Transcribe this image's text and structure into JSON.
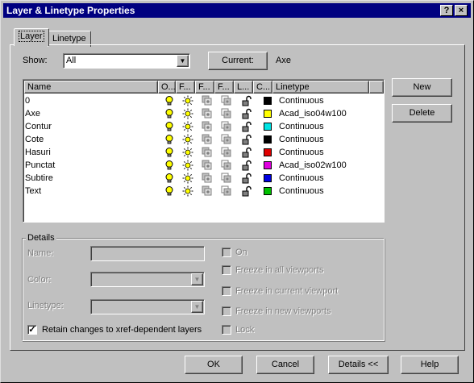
{
  "window": {
    "title": "Layer & Linetype Properties",
    "help_glyph": "?",
    "close_glyph": "×"
  },
  "tabs": [
    {
      "label": "Layer",
      "active": true
    },
    {
      "label": "Linetype",
      "active": false
    }
  ],
  "filter": {
    "show_label": "Show:",
    "show_value": "All",
    "current_button": "Current:",
    "current_value": "Axe"
  },
  "buttons": {
    "new": "New",
    "delete": "Delete",
    "ok": "OK",
    "cancel": "Cancel",
    "details": "Details <<",
    "help": "Help"
  },
  "table": {
    "columns": [
      "Name",
      "O...",
      "F...",
      "F...",
      "F...",
      "L...",
      "C...",
      "Linetype"
    ],
    "rows": [
      {
        "name": "0",
        "color": "#000000",
        "linetype": "Continuous"
      },
      {
        "name": "Axe",
        "color": "#ffff00",
        "linetype": "Acad_iso04w100"
      },
      {
        "name": "Contur",
        "color": "#00e5e5",
        "linetype": "Continuous"
      },
      {
        "name": "Cote",
        "color": "#000000",
        "linetype": "Continuous"
      },
      {
        "name": "Hasuri",
        "color": "#e00000",
        "linetype": "Continuous"
      },
      {
        "name": "Punctat",
        "color": "#e000e0",
        "linetype": "Acad_iso02w100"
      },
      {
        "name": "Subtire",
        "color": "#0000e0",
        "linetype": "Continuous"
      },
      {
        "name": "Text",
        "color": "#00c000",
        "linetype": "Continuous"
      }
    ]
  },
  "details": {
    "legend": "Details",
    "name_label": "Name:",
    "color_label": "Color:",
    "linetype_label": "Linetype:",
    "retain_label": "Retain changes to xref-dependent layers",
    "retain_checked": true,
    "options": [
      "On",
      "Freeze in all viewports",
      "Freeze in current viewport",
      "Freeze in new viewports",
      "Lock"
    ]
  },
  "icons": {
    "on": "lightbulb-icon",
    "freeze": "sun-icon",
    "freeze_current": "viewport-freeze-icon",
    "freeze_new": "new-viewport-freeze-icon",
    "lock": "padlock-open-icon"
  }
}
